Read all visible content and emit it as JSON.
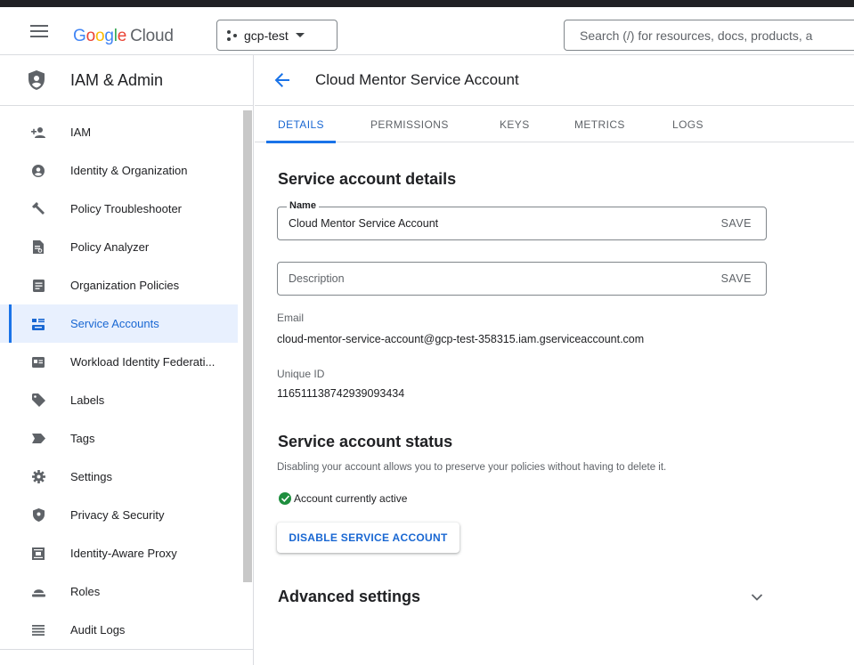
{
  "header": {
    "menu_icon": "hamburger-menu-icon",
    "logo": {
      "google": "Google",
      "cloud": "Cloud"
    },
    "project": {
      "icon": "project-dots-icon",
      "label": "gcp-test"
    },
    "search": {
      "placeholder": "Search (/) for resources, docs, products, a"
    }
  },
  "sidebar": {
    "title": "IAM & Admin",
    "title_icon": "shield-icon",
    "items": [
      {
        "label": "IAM",
        "icon": "person-add-icon"
      },
      {
        "label": "Identity & Organization",
        "icon": "account-circle-icon"
      },
      {
        "label": "Policy Troubleshooter",
        "icon": "wrench-icon"
      },
      {
        "label": "Policy Analyzer",
        "icon": "document-search-icon"
      },
      {
        "label": "Organization Policies",
        "icon": "policy-doc-icon"
      },
      {
        "label": "Service Accounts",
        "icon": "service-account-icon",
        "active": true
      },
      {
        "label": "Workload Identity Federati...",
        "icon": "badge-icon"
      },
      {
        "label": "Labels",
        "icon": "label-icon"
      },
      {
        "label": "Tags",
        "icon": "tag-icon"
      },
      {
        "label": "Settings",
        "icon": "gear-icon"
      },
      {
        "label": "Privacy & Security",
        "icon": "shield-small-icon"
      },
      {
        "label": "Identity-Aware Proxy",
        "icon": "proxy-icon"
      },
      {
        "label": "Roles",
        "icon": "roles-icon"
      },
      {
        "label": "Audit Logs",
        "icon": "list-icon"
      }
    ]
  },
  "page": {
    "back_icon": "arrow-back-icon",
    "title": "Cloud Mentor Service Account",
    "tabs": [
      "DETAILS",
      "PERMISSIONS",
      "KEYS",
      "METRICS",
      "LOGS"
    ],
    "active_tab": "DETAILS"
  },
  "details": {
    "heading": "Service account details",
    "name_label": "Name",
    "name_value": "Cloud Mentor Service Account",
    "description_placeholder": "Description",
    "save_label": "SAVE",
    "email_label": "Email",
    "email_value": "cloud-mentor-service-account@gcp-test-358315.iam.gserviceaccount.com",
    "unique_id_label": "Unique ID",
    "unique_id_value": "116511138742939093434"
  },
  "status": {
    "heading": "Service account status",
    "description": "Disabling your account allows you to preserve your policies without having to delete it.",
    "state_icon": "check-circle-icon",
    "state_text": "Account currently active",
    "state_color": "#1e8e3e",
    "disable_button": "DISABLE SERVICE ACCOUNT"
  },
  "advanced": {
    "heading": "Advanced settings",
    "chevron_icon": "chevron-down-icon"
  },
  "colors": {
    "accent": "#1a73e8",
    "active_text": "#1967d2",
    "active_bg": "#e8f0fe"
  }
}
